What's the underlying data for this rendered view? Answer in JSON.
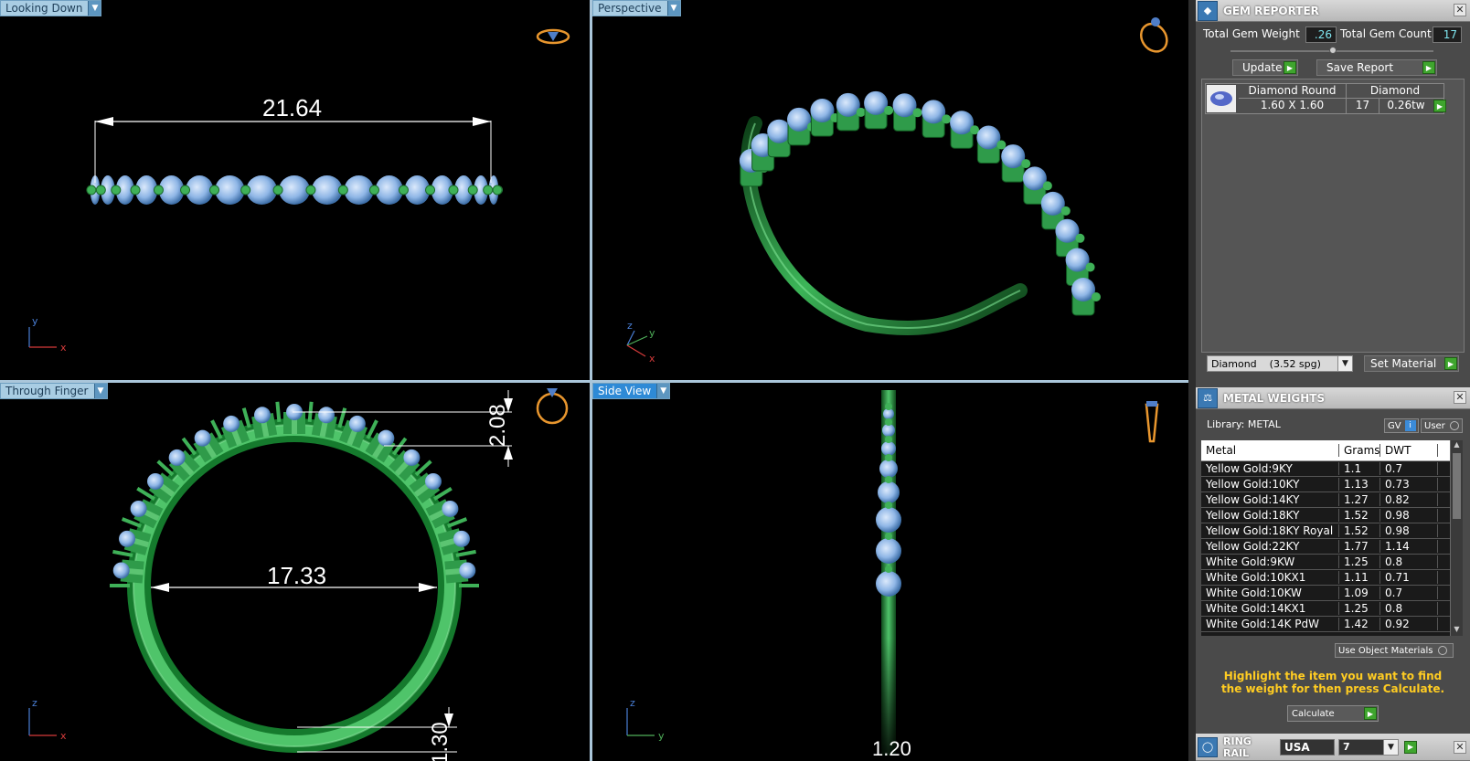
{
  "viewports": {
    "top_left": {
      "label": "Looking Down",
      "dimension": "21.64"
    },
    "top_right": {
      "label": "Perspective"
    },
    "bottom_left": {
      "label": "Through Finger",
      "dimension_main": "17.33",
      "dimension_top": "2.08",
      "dimension_bottom": "1.30"
    },
    "bottom_right": {
      "label": "Side View",
      "dimension_bottom": "1.20"
    },
    "axes": {
      "x": "x",
      "y": "y",
      "z": "z"
    }
  },
  "gem_reporter": {
    "title": "GEM REPORTER",
    "total_gem_weight_label": "Total Gem Weight",
    "total_gem_weight": ".26",
    "total_gem_count_label": "Total Gem Count",
    "total_gem_count": "17",
    "update_label": "Update",
    "save_report_label": "Save Report",
    "gem": {
      "type": "Diamond Round",
      "material": "Diamond",
      "size": "1.60 X 1.60",
      "count": "17",
      "weight": "0.26tw"
    },
    "material_select": "Diamond    (3.52 spg)",
    "set_material_label": "Set Material"
  },
  "metal_weights": {
    "title": "METAL WEIGHTS",
    "library_label": "Library: METAL",
    "gv_label": "GV",
    "gv_info": "i",
    "user_label": "User",
    "columns": [
      "Metal",
      "Grams",
      "DWT"
    ],
    "rows": [
      [
        "Yellow Gold:9KY",
        "1.1",
        "0.7"
      ],
      [
        "Yellow Gold:10KY",
        "1.13",
        "0.73"
      ],
      [
        "Yellow Gold:14KY",
        "1.27",
        "0.82"
      ],
      [
        "Yellow Gold:18KY",
        "1.52",
        "0.98"
      ],
      [
        "Yellow Gold:18KY Royal",
        "1.52",
        "0.98"
      ],
      [
        "Yellow Gold:22KY",
        "1.77",
        "1.14"
      ],
      [
        "White Gold:9KW",
        "1.25",
        "0.8"
      ],
      [
        "White Gold:10KX1",
        "1.11",
        "0.71"
      ],
      [
        "White Gold:10KW",
        "1.09",
        "0.7"
      ],
      [
        "White Gold:14KX1",
        "1.25",
        "0.8"
      ],
      [
        "White Gold:14K PdW",
        "1.42",
        "0.92"
      ]
    ],
    "use_object_materials": "Use Object Materials",
    "hint": "Highlight the item you want to find the weight for then press Calculate.",
    "calculate_label": "Calculate"
  },
  "ring_rail": {
    "title": "RING RAIL",
    "country": "USA",
    "size": "7"
  },
  "colors": {
    "metal": "#2f9b4a",
    "gem": "#8fb6e6",
    "accent": "#2e8ad6"
  }
}
